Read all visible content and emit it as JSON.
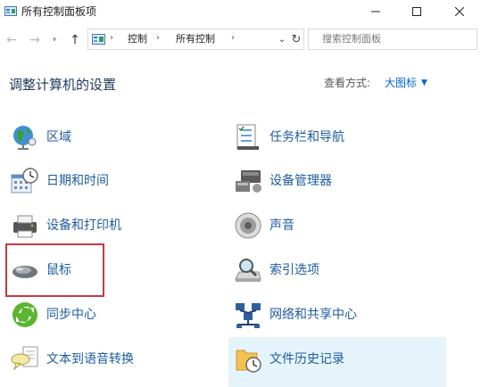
{
  "window": {
    "title": "所有控制面板项",
    "icons": {
      "app": "control-panel-icon",
      "minimize": "minimize-icon",
      "maximize": "maximize-icon",
      "close": "close-icon"
    }
  },
  "navigation": {
    "back": "←",
    "forward": "→",
    "up": "↑",
    "address_segments": [
      "控制",
      "所有控制"
    ],
    "search_placeholder": "搜索控制面板",
    "icons": [
      "back-arrow-icon",
      "forward-arrow-icon",
      "recent-dropdown-icon",
      "up-arrow-icon",
      "refresh-icon",
      "search-icon"
    ]
  },
  "header": {
    "title": "调整计算机的设置",
    "view_by_label": "查看方式:",
    "view_by_value": "大图标"
  },
  "items_left": [
    {
      "label": "区域",
      "icon": "region-globe-icon"
    },
    {
      "label": "日期和时间",
      "icon": "date-time-icon"
    },
    {
      "label": "设备和打印机",
      "icon": "printer-icon"
    },
    {
      "label": "鼠标",
      "icon": "mouse-icon"
    },
    {
      "label": "同步中心",
      "icon": "sync-center-icon"
    },
    {
      "label": "文本到语音转换",
      "icon": "text-to-speech-icon"
    }
  ],
  "items_right": [
    {
      "label": "任务栏和导航",
      "icon": "taskbar-icon"
    },
    {
      "label": "设备管理器",
      "icon": "device-manager-icon"
    },
    {
      "label": "声音",
      "icon": "speaker-icon"
    },
    {
      "label": "索引选项",
      "icon": "indexing-icon"
    },
    {
      "label": "网络和共享中心",
      "icon": "network-icon"
    },
    {
      "label": "文件历史记录",
      "icon": "file-history-icon"
    }
  ],
  "colors": {
    "link": "#1d5b9f",
    "header": "#1e395b",
    "highlight": "#e5f3fb",
    "annotation_box": "#c9393f"
  }
}
